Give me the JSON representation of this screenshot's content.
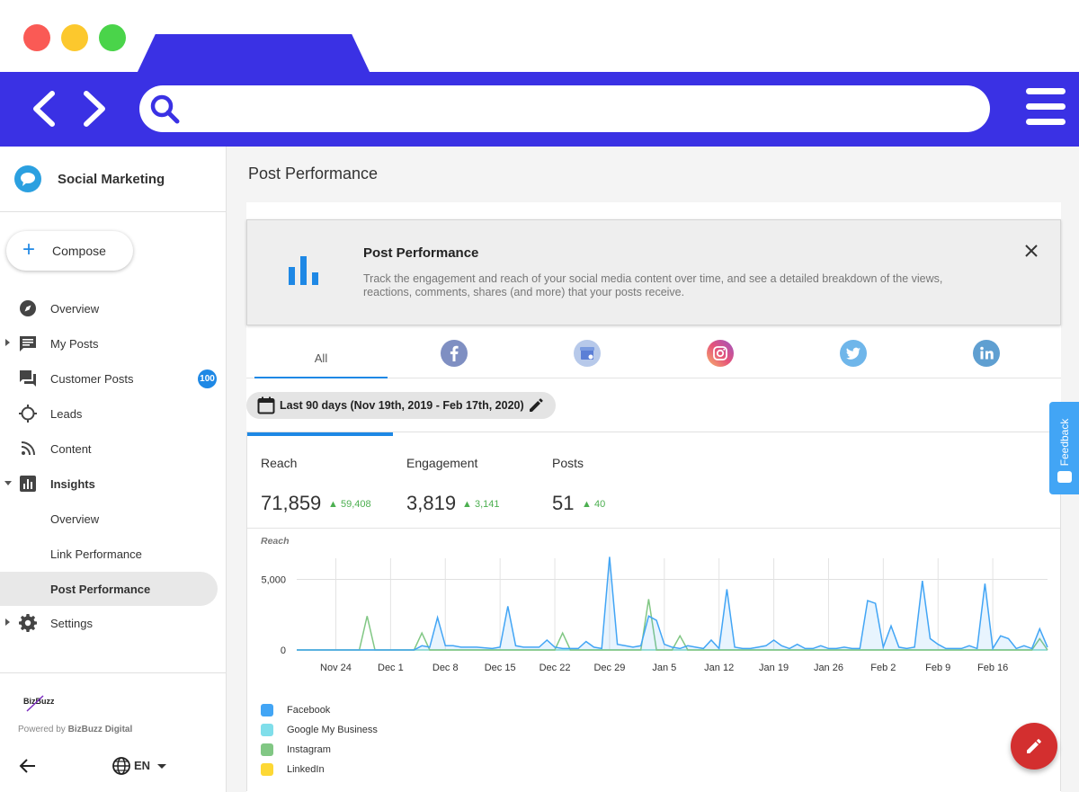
{
  "app": {
    "name": "Social Marketing"
  },
  "sidebar": {
    "compose_label": "Compose",
    "items": [
      {
        "label": "Overview",
        "icon": "compass-icon"
      },
      {
        "label": "My Posts",
        "icon": "message-icon"
      },
      {
        "label": "Customer Posts",
        "icon": "chat-icon",
        "badge": "100"
      },
      {
        "label": "Leads",
        "icon": "target-icon"
      },
      {
        "label": "Content",
        "icon": "rss-icon"
      },
      {
        "label": "Insights",
        "icon": "chart-icon"
      },
      {
        "label": "Overview"
      },
      {
        "label": "Link Performance"
      },
      {
        "label": "Post Performance"
      },
      {
        "label": "Settings",
        "icon": "gear-icon"
      }
    ],
    "footer": {
      "logo_text": "BizBuzz",
      "powered_prefix": "Powered by ",
      "powered_brand": "BizBuzz Digital",
      "language": "EN"
    }
  },
  "page": {
    "title": "Post Performance"
  },
  "info_card": {
    "title": "Post Performance",
    "description": "Track the engagement and reach of your social media content over time, and see a detailed breakdown of the views, reactions, comments, shares (and more) that your posts receive."
  },
  "network_tabs": [
    {
      "label": "All"
    },
    {
      "icon": "facebook-icon"
    },
    {
      "icon": "google-my-business-icon"
    },
    {
      "icon": "instagram-icon"
    },
    {
      "icon": "twitter-icon"
    },
    {
      "icon": "linkedin-icon"
    }
  ],
  "date_range": {
    "label": "Last 90 days (Nov 19th, 2019 - Feb 17th, 2020)"
  },
  "metrics": [
    {
      "label": "Reach",
      "value": "71,859",
      "delta": "59,408"
    },
    {
      "label": "Engagement",
      "value": "3,819",
      "delta": "3,141"
    },
    {
      "label": "Posts",
      "value": "51",
      "delta": "40"
    }
  ],
  "colors": {
    "accent": "#1e88e5",
    "browser": "#3a31e4",
    "positive": "#4caf50",
    "fab": "#d32f2f"
  },
  "feedback": {
    "label": "Feedback"
  },
  "chart_data": {
    "type": "line",
    "title": "Reach",
    "x_ticks": [
      "Nov 24",
      "Dec 1",
      "Dec 8",
      "Dec 15",
      "Dec 22",
      "Dec 29",
      "Jan 5",
      "Jan 12",
      "Jan 19",
      "Jan 26",
      "Feb 2",
      "Feb 9",
      "Feb 16"
    ],
    "y_ticks": [
      "0",
      "5,000"
    ],
    "ylim": [
      0,
      6500
    ],
    "x_range": [
      "Nov 19",
      "Feb 17"
    ],
    "grid": true,
    "legend_position": "bottom-left",
    "series": [
      {
        "name": "Facebook",
        "color": "#42a5f5",
        "values": [
          0,
          0,
          0,
          0,
          0,
          0,
          0,
          0,
          0,
          0,
          0,
          0,
          0,
          0,
          0,
          0,
          300,
          200,
          2300,
          300,
          300,
          200,
          200,
          200,
          150,
          100,
          200,
          3100,
          300,
          200,
          200,
          200,
          700,
          200,
          100,
          100,
          100,
          600,
          200,
          100,
          6600,
          400,
          300,
          200,
          300,
          2400,
          2100,
          400,
          200,
          100,
          300,
          200,
          100,
          700,
          100,
          4300,
          200,
          100,
          100,
          200,
          300,
          700,
          300,
          100,
          400,
          100,
          100,
          300,
          100,
          100,
          200,
          100,
          100,
          3500,
          3300,
          200,
          1700,
          200,
          100,
          200,
          4900,
          800,
          400,
          100,
          100,
          100,
          300,
          100,
          4700,
          100,
          1000,
          800,
          100,
          300,
          100,
          1500,
          200
        ]
      },
      {
        "name": "Google My Business",
        "color": "#80deea",
        "values": [
          0,
          0,
          0,
          0,
          0,
          0,
          0,
          0,
          0,
          0,
          0,
          0,
          0,
          0,
          0,
          0,
          0,
          0,
          0,
          0,
          0,
          0,
          0,
          0,
          0,
          0,
          0,
          0,
          0,
          0,
          0,
          0,
          0,
          0,
          0,
          0,
          0,
          0,
          0,
          0,
          0,
          0,
          0,
          0,
          0,
          0,
          0,
          0,
          0,
          0,
          0,
          0,
          0,
          0,
          0,
          0,
          0,
          0,
          0,
          0,
          0,
          0,
          0,
          0,
          0,
          0,
          0,
          0,
          0,
          0,
          0,
          0,
          0,
          0,
          0,
          0,
          0,
          0,
          0,
          0,
          0,
          0,
          0,
          0,
          0,
          0,
          0,
          0,
          0,
          0,
          0,
          0,
          0,
          0,
          0,
          0,
          0
        ]
      },
      {
        "name": "Instagram",
        "color": "#81c784",
        "values": [
          0,
          0,
          0,
          0,
          0,
          0,
          0,
          0,
          0,
          2400,
          0,
          0,
          0,
          0,
          0,
          0,
          1200,
          0,
          0,
          0,
          0,
          0,
          0,
          0,
          0,
          0,
          0,
          0,
          0,
          0,
          0,
          0,
          0,
          0,
          1200,
          0,
          0,
          0,
          0,
          0,
          0,
          0,
          0,
          0,
          0,
          3600,
          0,
          0,
          0,
          1000,
          0,
          0,
          0,
          0,
          0,
          0,
          0,
          0,
          0,
          0,
          0,
          0,
          0,
          0,
          0,
          0,
          0,
          0,
          0,
          0,
          0,
          0,
          0,
          0,
          0,
          0,
          0,
          0,
          0,
          0,
          0,
          0,
          0,
          0,
          0,
          0,
          0,
          0,
          0,
          0,
          0,
          0,
          0,
          0,
          0,
          800,
          0
        ]
      },
      {
        "name": "LinkedIn",
        "color": "#fdd835",
        "values": [
          0,
          0,
          0,
          0,
          0,
          0,
          0,
          0,
          0,
          0,
          0,
          0,
          0,
          0,
          0,
          0,
          0,
          0,
          0,
          0,
          0,
          0,
          0,
          0,
          0,
          0,
          0,
          0,
          0,
          0,
          0,
          0,
          0,
          0,
          0,
          0,
          0,
          0,
          0,
          0,
          0,
          0,
          0,
          0,
          0,
          0,
          0,
          0,
          0,
          0,
          0,
          0,
          0,
          0,
          0,
          0,
          0,
          0,
          0,
          0,
          0,
          0,
          0,
          0,
          0,
          0,
          0,
          0,
          0,
          0,
          0,
          0,
          0,
          0,
          0,
          0,
          0,
          0,
          0,
          0,
          0,
          0,
          0,
          0,
          0,
          0,
          0,
          0,
          0,
          0,
          0,
          0,
          0,
          0,
          0,
          0,
          0
        ]
      }
    ]
  }
}
